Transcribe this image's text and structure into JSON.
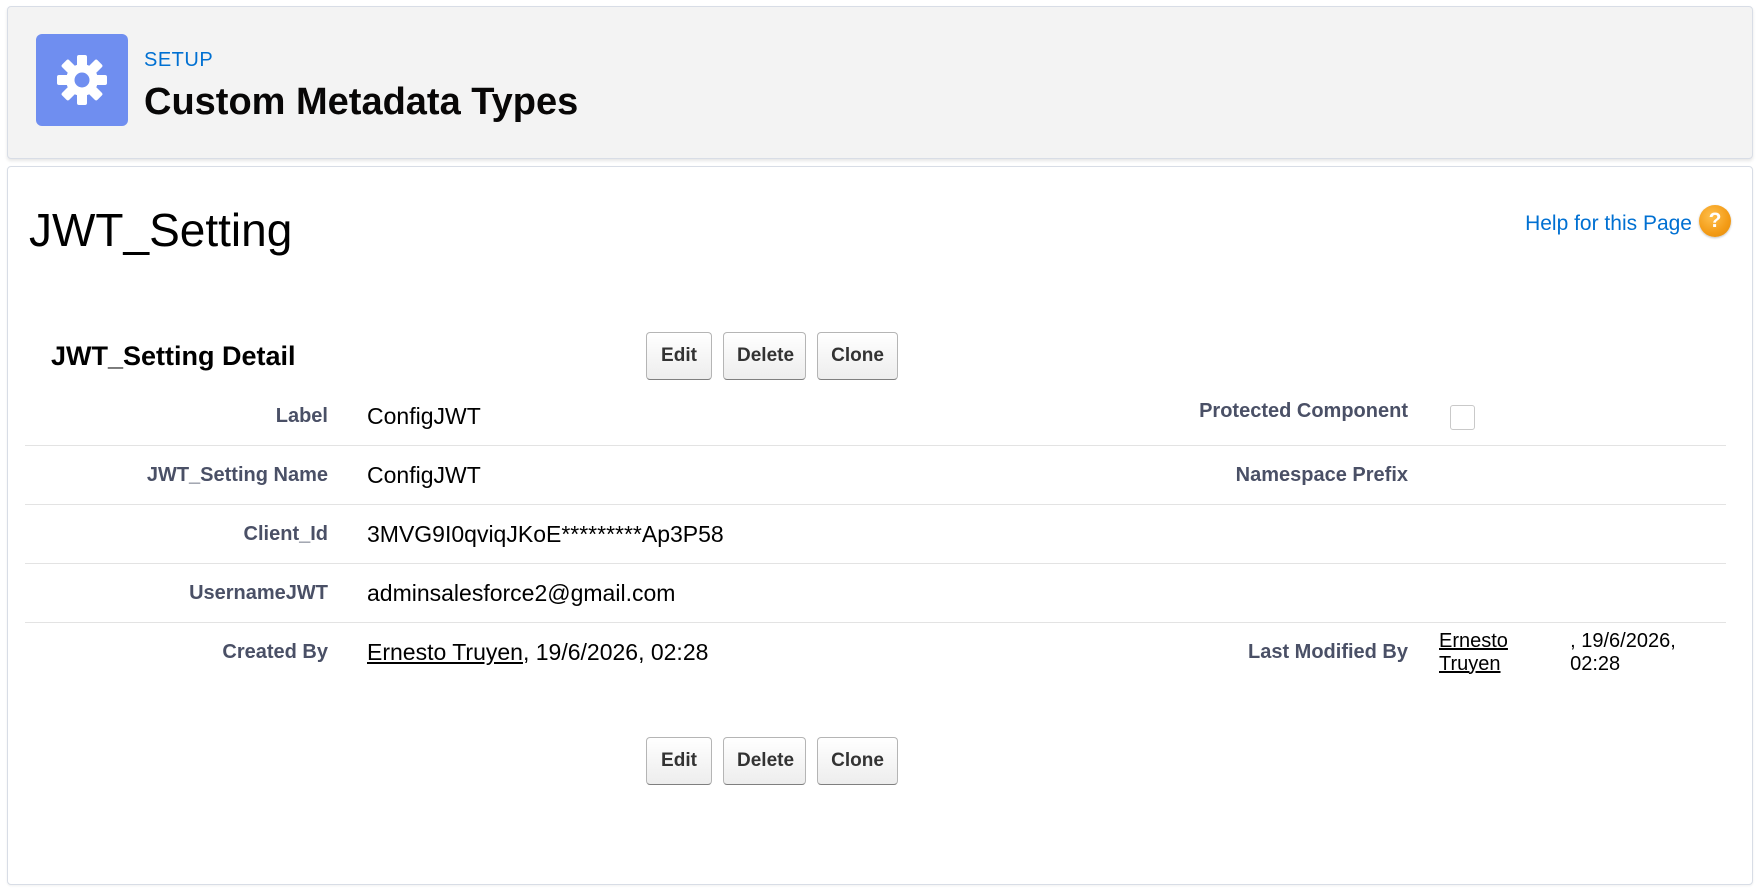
{
  "header": {
    "breadcrumb": "SETUP",
    "title": "Custom Metadata Types",
    "icon": "gear-icon",
    "icon_color": "#6f8ef0"
  },
  "page": {
    "title": "JWT_Setting",
    "help_link": "Help for this Page",
    "help_icon": "question-icon",
    "help_icon_glyph": "?"
  },
  "section": {
    "title": "JWT_Setting Detail"
  },
  "buttons": {
    "edit": "Edit",
    "delete": "Delete",
    "clone": "Clone"
  },
  "fields": {
    "label": {
      "label": "Label",
      "value": "ConfigJWT"
    },
    "name": {
      "label": "JWT_Setting Name",
      "value": "ConfigJWT"
    },
    "client_id": {
      "label": "Client_Id",
      "value": "3MVG9I0qviqJKoE*********Ap3P58"
    },
    "username": {
      "label": "UsernameJWT",
      "value": "adminsalesforce2@gmail.com"
    },
    "created_by": {
      "label": "Created By",
      "user": "Ernesto Truyen",
      "date": ", 19/6/2026, 02:28"
    },
    "protected": {
      "label": "Protected Component",
      "checked": false
    },
    "namespace": {
      "label": "Namespace Prefix",
      "value": ""
    },
    "last_modified_by": {
      "label": "Last Modified By",
      "user": "Ernesto Truyen",
      "date": ", 19/6/2026, 02:28"
    }
  },
  "colors": {
    "link": "#0070d2",
    "field_label": "#4a5066",
    "help_icon": "#f39b16"
  }
}
